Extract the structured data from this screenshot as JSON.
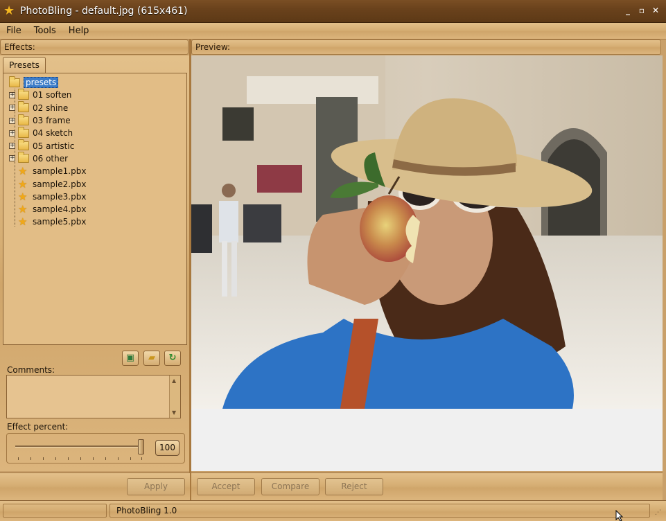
{
  "window": {
    "title": "PhotoBling - default.jpg (615x461)",
    "app_icon": "star-icon",
    "controls": [
      "minimize-icon",
      "maximize-icon",
      "close-icon"
    ]
  },
  "menu": [
    "File",
    "Tools",
    "Help"
  ],
  "effects_header": "Effects:",
  "preview_header": "Preview:",
  "tabs": [
    "Presets"
  ],
  "tree": {
    "root": "presets",
    "folders": [
      "01 soften",
      "02 shine",
      "03 frame",
      "04 sketch",
      "05 artistic",
      "06 other"
    ],
    "files": [
      "sample1.pbx",
      "sample2.pbx",
      "sample3.pbx",
      "sample4.pbx",
      "sample5.pbx"
    ]
  },
  "toolbar_icons": [
    "new-preset-icon",
    "open-folder-icon",
    "refresh-icon"
  ],
  "comments": {
    "label": "Comments:",
    "value": ""
  },
  "effect_percent": {
    "label": "Effect percent:",
    "value": "100"
  },
  "buttons": {
    "apply": "Apply",
    "accept": "Accept",
    "compare": "Compare",
    "reject": "Reject"
  },
  "status": {
    "left": "",
    "main": "PhotoBling 1.0"
  },
  "colors": {
    "title_bar": "#6a421c",
    "wood_panel": "#d6ae74",
    "selection": "#3c7cc8",
    "preview_bg": "#f0f0f0"
  }
}
